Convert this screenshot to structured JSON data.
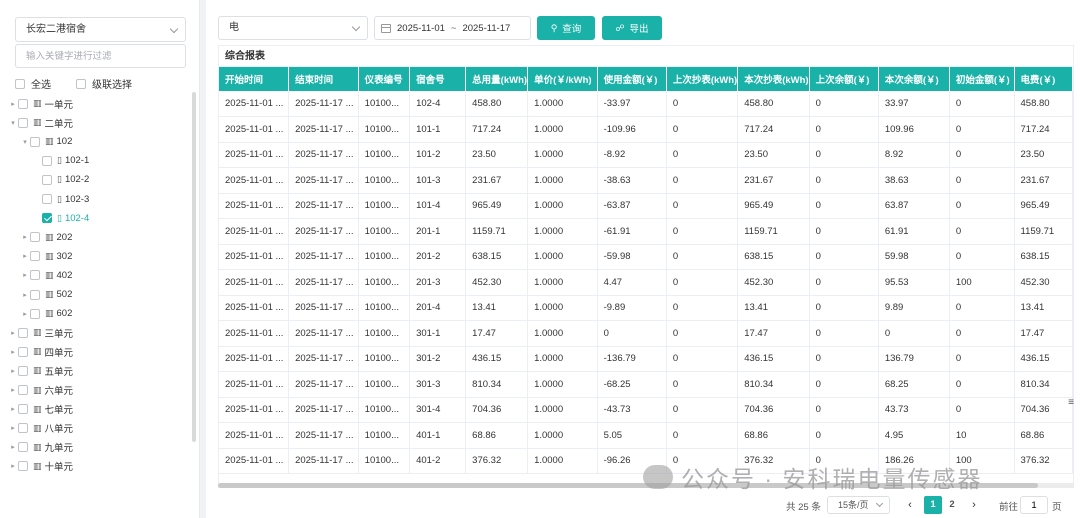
{
  "sidebar": {
    "dorm_select": "长宏二港宿舍",
    "filter_placeholder": "输入关键字进行过滤",
    "select_all_label": "全选",
    "cascade_label": "级联选择",
    "tree": [
      {
        "label": "一单元",
        "level": 0,
        "expanded": false,
        "checked": false,
        "icon": "building-icon"
      },
      {
        "label": "二单元",
        "level": 0,
        "expanded": true,
        "checked": false,
        "icon": "building-icon"
      },
      {
        "label": "102",
        "level": 1,
        "expanded": true,
        "checked": false,
        "icon": "building-icon"
      },
      {
        "label": "102-1",
        "level": 2,
        "expanded": null,
        "checked": false,
        "icon": "room-icon"
      },
      {
        "label": "102-2",
        "level": 2,
        "expanded": null,
        "checked": false,
        "icon": "room-icon"
      },
      {
        "label": "102-3",
        "level": 2,
        "expanded": null,
        "checked": false,
        "icon": "room-icon"
      },
      {
        "label": "102-4",
        "level": 2,
        "expanded": null,
        "checked": true,
        "icon": "room-icon"
      },
      {
        "label": "202",
        "level": 1,
        "expanded": false,
        "checked": false,
        "icon": "building-icon"
      },
      {
        "label": "302",
        "level": 1,
        "expanded": false,
        "checked": false,
        "icon": "building-icon"
      },
      {
        "label": "402",
        "level": 1,
        "expanded": false,
        "checked": false,
        "icon": "building-icon"
      },
      {
        "label": "502",
        "level": 1,
        "expanded": false,
        "checked": false,
        "icon": "building-icon"
      },
      {
        "label": "602",
        "level": 1,
        "expanded": false,
        "checked": false,
        "icon": "building-icon"
      },
      {
        "label": "三单元",
        "level": 0,
        "expanded": false,
        "checked": false,
        "icon": "building-icon"
      },
      {
        "label": "四单元",
        "level": 0,
        "expanded": false,
        "checked": false,
        "icon": "building-icon"
      },
      {
        "label": "五单元",
        "level": 0,
        "expanded": false,
        "checked": false,
        "icon": "building-icon"
      },
      {
        "label": "六单元",
        "level": 0,
        "expanded": false,
        "checked": false,
        "icon": "building-icon"
      },
      {
        "label": "七单元",
        "level": 0,
        "expanded": false,
        "checked": false,
        "icon": "building-icon"
      },
      {
        "label": "八单元",
        "level": 0,
        "expanded": false,
        "checked": false,
        "icon": "building-icon"
      },
      {
        "label": "九单元",
        "level": 0,
        "expanded": false,
        "checked": false,
        "icon": "building-icon"
      },
      {
        "label": "十单元",
        "level": 0,
        "expanded": false,
        "checked": false,
        "icon": "building-icon"
      }
    ]
  },
  "toolbar": {
    "type_select": "电",
    "date_start": "2025-11-01",
    "date_sep": "~",
    "date_end": "2025-11-17",
    "query_label": "查询",
    "export_label": "导出"
  },
  "report": {
    "title": "综合报表",
    "columns": [
      "开始时间",
      "结束时间",
      "仪表编号",
      "宿舍号",
      "总用量(kWh)",
      "单价(￥/kWh)",
      "使用金额(￥)",
      "上次抄表(kWh)",
      "本次抄表(kWh)",
      "上次余额(￥)",
      "本次余额(￥)",
      "初始金额(￥)",
      "电费(￥)"
    ],
    "rows": [
      [
        "2025-11-01 ...",
        "2025-11-17 ...",
        "10100...",
        "102-4",
        "458.80",
        "1.0000",
        "-33.97",
        "0",
        "458.80",
        "0",
        "33.97",
        "0",
        "458.80"
      ],
      [
        "2025-11-01 ...",
        "2025-11-17 ...",
        "10100...",
        "101-1",
        "717.24",
        "1.0000",
        "-109.96",
        "0",
        "717.24",
        "0",
        "109.96",
        "0",
        "717.24"
      ],
      [
        "2025-11-01 ...",
        "2025-11-17 ...",
        "10100...",
        "101-2",
        "23.50",
        "1.0000",
        "-8.92",
        "0",
        "23.50",
        "0",
        "8.92",
        "0",
        "23.50"
      ],
      [
        "2025-11-01 ...",
        "2025-11-17 ...",
        "10100...",
        "101-3",
        "231.67",
        "1.0000",
        "-38.63",
        "0",
        "231.67",
        "0",
        "38.63",
        "0",
        "231.67"
      ],
      [
        "2025-11-01 ...",
        "2025-11-17 ...",
        "10100...",
        "101-4",
        "965.49",
        "1.0000",
        "-63.87",
        "0",
        "965.49",
        "0",
        "63.87",
        "0",
        "965.49"
      ],
      [
        "2025-11-01 ...",
        "2025-11-17 ...",
        "10100...",
        "201-1",
        "1159.71",
        "1.0000",
        "-61.91",
        "0",
        "1159.71",
        "0",
        "61.91",
        "0",
        "1159.71"
      ],
      [
        "2025-11-01 ...",
        "2025-11-17 ...",
        "10100...",
        "201-2",
        "638.15",
        "1.0000",
        "-59.98",
        "0",
        "638.15",
        "0",
        "59.98",
        "0",
        "638.15"
      ],
      [
        "2025-11-01 ...",
        "2025-11-17 ...",
        "10100...",
        "201-3",
        "452.30",
        "1.0000",
        "4.47",
        "0",
        "452.30",
        "0",
        "95.53",
        "100",
        "452.30"
      ],
      [
        "2025-11-01 ...",
        "2025-11-17 ...",
        "10100...",
        "201-4",
        "13.41",
        "1.0000",
        "-9.89",
        "0",
        "13.41",
        "0",
        "9.89",
        "0",
        "13.41"
      ],
      [
        "2025-11-01 ...",
        "2025-11-17 ...",
        "10100...",
        "301-1",
        "17.47",
        "1.0000",
        "0",
        "0",
        "17.47",
        "0",
        "0",
        "0",
        "17.47"
      ],
      [
        "2025-11-01 ...",
        "2025-11-17 ...",
        "10100...",
        "301-2",
        "436.15",
        "1.0000",
        "-136.79",
        "0",
        "436.15",
        "0",
        "136.79",
        "0",
        "436.15"
      ],
      [
        "2025-11-01 ...",
        "2025-11-17 ...",
        "10100...",
        "301-3",
        "810.34",
        "1.0000",
        "-68.25",
        "0",
        "810.34",
        "0",
        "68.25",
        "0",
        "810.34"
      ],
      [
        "2025-11-01 ...",
        "2025-11-17 ...",
        "10100...",
        "301-4",
        "704.36",
        "1.0000",
        "-43.73",
        "0",
        "704.36",
        "0",
        "43.73",
        "0",
        "704.36"
      ],
      [
        "2025-11-01 ...",
        "2025-11-17 ...",
        "10100...",
        "401-1",
        "68.86",
        "1.0000",
        "5.05",
        "0",
        "68.86",
        "0",
        "4.95",
        "10",
        "68.86"
      ],
      [
        "2025-11-01 ...",
        "2025-11-17 ...",
        "10100...",
        "401-2",
        "376.32",
        "1.0000",
        "-96.26",
        "0",
        "376.32",
        "0",
        "186.26",
        "100",
        "376.32"
      ]
    ]
  },
  "pagination": {
    "total_label": "共 25 条",
    "page_size": "15条/页",
    "prev_icon": "‹",
    "next_icon": "›",
    "pages": [
      "1",
      "2"
    ],
    "current_page": "1",
    "goto_label": "前往",
    "goto_value": "1",
    "goto_suffix": "页"
  },
  "watermark": "公众号 · 安科瑞电量传感器",
  "colors": {
    "accent": "#1ab1a8"
  }
}
